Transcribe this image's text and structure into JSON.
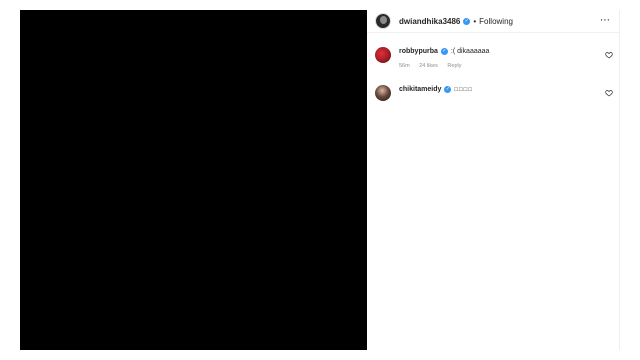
{
  "post": {
    "author": "dwiandhika3486",
    "separator": "•",
    "follow_label": "Following",
    "more_label": "⋯"
  },
  "comments": [
    {
      "username": "robbypurba",
      "text": ":( dikaaaaaa",
      "time": "56m",
      "likes": "24 likes",
      "reply_label": "Reply"
    },
    {
      "username": "chikitameidy",
      "text": "□□□□"
    }
  ],
  "colors": {
    "verified": "#3897f0",
    "media_background": "#000000",
    "meta_text": "#8e8e8e"
  }
}
